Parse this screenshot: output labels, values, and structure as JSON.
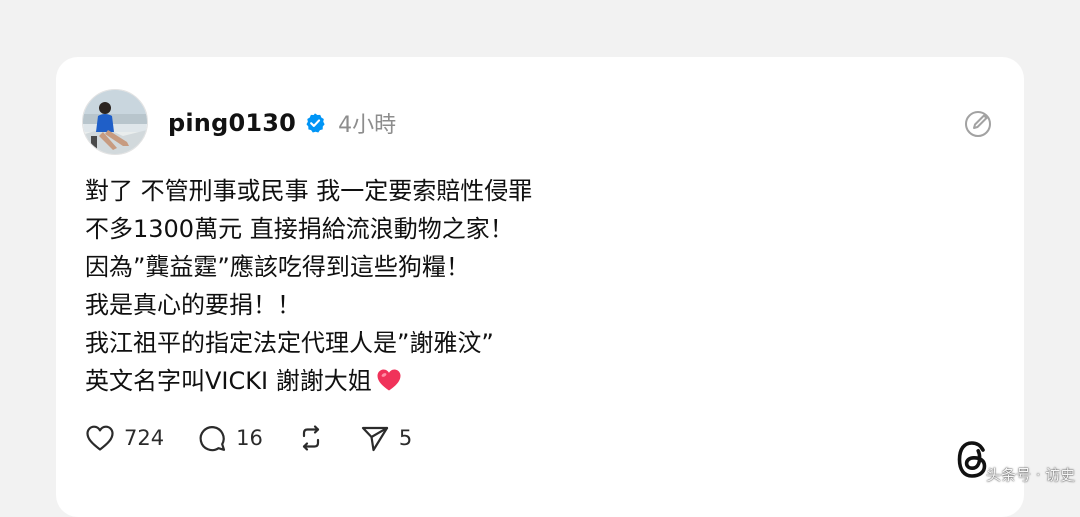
{
  "post": {
    "username": "ping0130",
    "timestamp": "4小時",
    "lines": [
      "對了 不管刑事或民事 我一定要索賠性侵罪",
      "不多1300萬元 直接捐給流浪動物之家！",
      "因為”龔益霆”應該吃得到這些狗糧！",
      "我是真心的要捐！！",
      "我江祖平的指定法定代理人是”謝雅汶”",
      "英文名字叫VICKI 謝謝大姐"
    ],
    "stats": {
      "likes": "724",
      "comments": "16",
      "shares": "5"
    }
  },
  "watermark": "头条号 · 访史",
  "colors": {
    "verified": "#0095f6",
    "heart_emoji": "#f0325a",
    "muted": "#8d8d8d"
  }
}
